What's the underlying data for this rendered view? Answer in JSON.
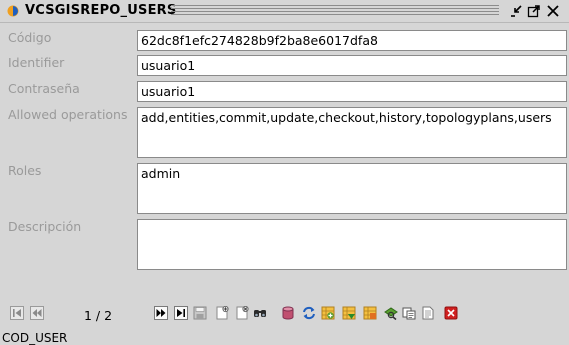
{
  "window": {
    "title": "VCSGISREPO_USERS"
  },
  "form": {
    "codigo": {
      "label": "Código",
      "value": "62dc8f1efc274828b9f2ba8e6017dfa8"
    },
    "identifier": {
      "label": "Identifier",
      "value": "usuario1"
    },
    "contrasena": {
      "label": "Contraseña",
      "value": "usuario1"
    },
    "allowed_ops": {
      "label": "Allowed operations",
      "value": "add,entities,commit,update,checkout,history,topologyplans,users"
    },
    "roles": {
      "label": "Roles",
      "value": "admin"
    },
    "descripcion": {
      "label": "Descripción",
      "value": ""
    }
  },
  "navigation": {
    "page_indicator": "1 / 2"
  },
  "toolbar_icons": [
    "first-record-icon",
    "previous-record-icon",
    "next-record-icon",
    "last-record-icon",
    "save-icon",
    "new-record-icon",
    "delete-record-icon",
    "search-icon",
    "database-icon",
    "refresh-icon",
    "filter-add-icon",
    "filter-down-icon",
    "filter-icon",
    "find-icon",
    "copy-icon",
    "export-icon",
    "close-icon"
  ],
  "status_bar": {
    "text": "COD_USER"
  },
  "colors": {
    "background": "#d6d6d6",
    "field_background": "#ffffff",
    "label_text": "#9a9a9a",
    "app_icon_orange": "#f0a020",
    "app_icon_blue": "#2060c0",
    "close_red": "#d02020"
  }
}
